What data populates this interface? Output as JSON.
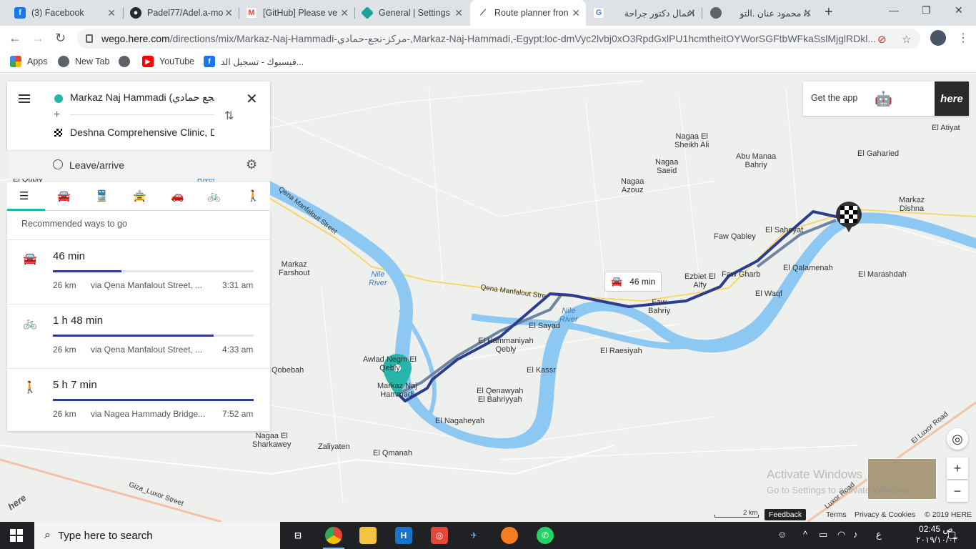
{
  "browser": {
    "tabs": [
      {
        "label": "(3) Facebook",
        "icon": "facebook-icon",
        "color": "#1877f2"
      },
      {
        "label": "Padel77/Adel.a-mo",
        "icon": "github-icon",
        "color": "#24292e"
      },
      {
        "label": "[GitHub] Please ve",
        "icon": "gmail-icon",
        "color": "#ea4335"
      },
      {
        "label": "General | Settings",
        "icon": "settings-diamond-icon",
        "color": "#1aa39a"
      },
      {
        "label": "Route planner fron",
        "icon": "here-route-icon",
        "color": "#2c3d8f"
      },
      {
        "label": "اعمال دكتور جراحة",
        "icon": "google-icon",
        "color": "#4285f4"
      },
      {
        "label": "د/ محمود عنان .التو",
        "icon": "globe-icon",
        "color": "#5f6368"
      }
    ],
    "url_domain": "wego.here.com",
    "url_path": "/directions/mix/Markaz-Naj-Hammadi-مركز-نجع-حمادي-,Markaz-Naj-Hammadi,-Egypt:loc-dmVyc2lvbj0xO3RpdGxlPU1hcmtheitOYWorSGFtbWFkaSslMjglRDkl...",
    "bookmarks": [
      {
        "label": "Apps",
        "icon": "apps-grid-icon"
      },
      {
        "label": "New Tab",
        "icon": "globe-icon"
      },
      {
        "label": "YouTube",
        "icon": "youtube-icon"
      },
      {
        "label": "فيسبوك - تسجيل الد...",
        "icon": "facebook-icon"
      }
    ]
  },
  "panel": {
    "origin": "Markaz Naj Hammadi (نجع حمادي",
    "destination": "Deshna Comprehensive Clinic, D",
    "leave_arrive": "Leave/arrive",
    "recommended": "Recommended ways to go",
    "modes": [
      "list-icon",
      "car-icon",
      "transit-icon",
      "taxi-icon",
      "car-share-icon",
      "bike-icon",
      "walk-icon"
    ],
    "routes": [
      {
        "icon": "car-icon",
        "time": "46 min",
        "distance": "26 km",
        "via": "via Qena Manfalout Street, ...",
        "arrive": "3:31 am",
        "fill": 0.34
      },
      {
        "icon": "bike-icon",
        "time": "1 h  48 min",
        "distance": "26 km",
        "via": "via Qena Manfalout Street, ...",
        "arrive": "4:33 am",
        "fill": 0.8
      },
      {
        "icon": "walk-icon",
        "time": "5 h  7 min",
        "distance": "26 km",
        "via": "via Nagea Hammady Bridge...",
        "arrive": "7:52 am",
        "fill": 1.0
      }
    ]
  },
  "getapp": {
    "label": "Get the app",
    "brand": "here"
  },
  "bubble": {
    "time": "46 min"
  },
  "map": {
    "labels": [
      {
        "text": "El Atiyat",
        "kind": "town"
      },
      {
        "text": "Nagaa El\nSheikh Ali",
        "kind": "town"
      },
      {
        "text": "Abu Manaa\nBahriy",
        "kind": "town"
      },
      {
        "text": "El Gaharied",
        "kind": "town"
      },
      {
        "text": "Nagaa\nSaeid",
        "kind": "town"
      },
      {
        "text": "Nagaa\nAzouz",
        "kind": "town"
      },
      {
        "text": "Markaz\nDishna",
        "kind": "town"
      },
      {
        "text": "Faw Qabley",
        "kind": "town"
      },
      {
        "text": "El Saheyat",
        "kind": "town"
      },
      {
        "text": "Markaz\nFarshout",
        "kind": "town"
      },
      {
        "text": "Ezbiet El\nAlfy",
        "kind": "town"
      },
      {
        "text": "Faw Gharb",
        "kind": "town"
      },
      {
        "text": "El Qalamenah",
        "kind": "town"
      },
      {
        "text": "El Marashdah",
        "kind": "town"
      },
      {
        "text": "El Waqf",
        "kind": "town"
      },
      {
        "text": "Faw\nBahriy",
        "kind": "town"
      },
      {
        "text": "El Sayad",
        "kind": "town"
      },
      {
        "text": "El Hammaniyah\nQebly",
        "kind": "town"
      },
      {
        "text": "El Raesiyah",
        "kind": "town"
      },
      {
        "text": "Awlad Negm El\nQebly",
        "kind": "town"
      },
      {
        "text": "Qobebah",
        "kind": "town"
      },
      {
        "text": "Markaz Naj\nHammadi",
        "kind": "town"
      },
      {
        "text": "El Kassr",
        "kind": "town"
      },
      {
        "text": "El Qenawyah\nEl Bahriyyah",
        "kind": "town"
      },
      {
        "text": "El Nagaheyah",
        "kind": "town"
      },
      {
        "text": "Nagaa El\nSharkawey",
        "kind": "town"
      },
      {
        "text": "Zaliyaten",
        "kind": "town"
      },
      {
        "text": "El Qmanah",
        "kind": "town"
      },
      {
        "text": "El Qubly",
        "kind": "town"
      },
      {
        "text": "Nile\nRiver",
        "kind": "river"
      },
      {
        "text": "Nile\nRiver",
        "kind": "river"
      },
      {
        "text": "River",
        "kind": "river"
      },
      {
        "text": "Qena Manfalout Street",
        "kind": "road"
      },
      {
        "text": "Qena Manfalout Stre",
        "kind": "road"
      },
      {
        "text": "Giza_Luxor Street",
        "kind": "road"
      },
      {
        "text": "El Luxor Road",
        "kind": "road"
      },
      {
        "text": "Luxor Road",
        "kind": "road"
      }
    ],
    "activate_line1": "Activate Windows",
    "activate_line2": "Go to Settings to activate Windows.",
    "scale": "2 km",
    "feedback": "Feedback",
    "terms": "Terms",
    "privacy": "Privacy & Cookies",
    "copyright": "© 2019 HERE"
  },
  "taskbar": {
    "search_placeholder": "Type here to search",
    "time": "02:45 ص",
    "date": "٢٠١٩/١٠/٠٣",
    "lang": "ع",
    "apps": [
      "task-view-icon",
      "chrome-icon",
      "file-explorer-icon",
      "app-h-icon",
      "camera-app-icon",
      "vpn-bird-icon",
      "firefox-icon",
      "whatsapp-icon"
    ]
  },
  "colors": {
    "route": "#2c3d8f",
    "alt_route": "#6f84a1",
    "river": "#8cc8f2",
    "teal": "#26b5a9"
  }
}
